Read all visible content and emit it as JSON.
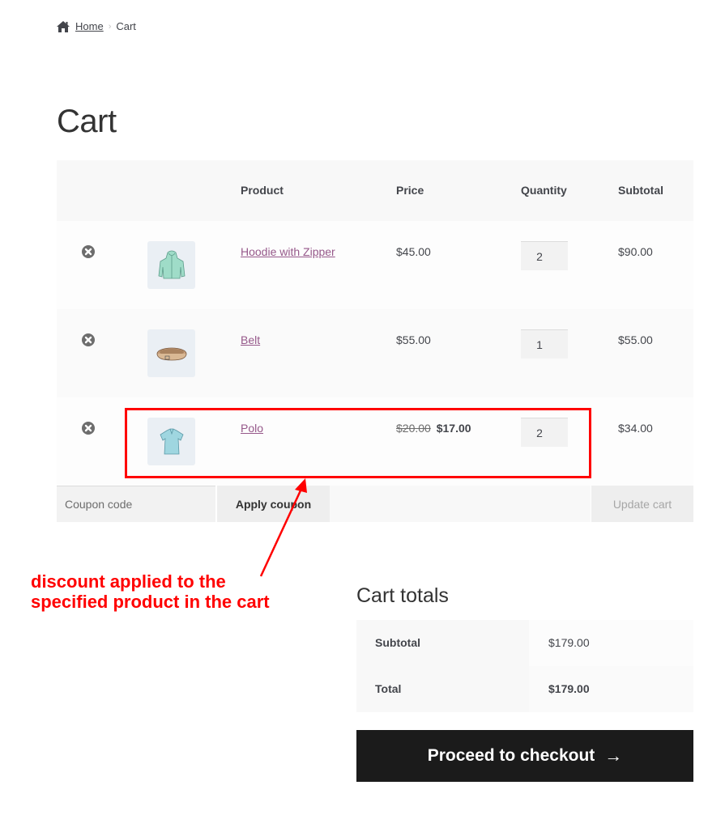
{
  "breadcrumb": {
    "home_label": "Home",
    "separator": "›",
    "current": "Cart"
  },
  "page": {
    "title": "Cart"
  },
  "table": {
    "headers": {
      "product": "Product",
      "price": "Price",
      "quantity": "Quantity",
      "subtotal": "Subtotal"
    },
    "rows": [
      {
        "name": "Hoodie with Zipper",
        "image": "hoodie-thumbnail",
        "price": "$45.00",
        "quantity": "2",
        "subtotal": "$90.00"
      },
      {
        "name": "Belt",
        "image": "belt-thumbnail",
        "price": "$55.00",
        "quantity": "1",
        "subtotal": "$55.00"
      },
      {
        "name": "Polo",
        "image": "polo-thumbnail",
        "regular_price": "$20.00",
        "sale_price": "$17.00",
        "quantity": "2",
        "subtotal": "$34.00"
      }
    ]
  },
  "actions": {
    "coupon_placeholder": "Coupon code",
    "apply_coupon": "Apply coupon",
    "update_cart": "Update cart"
  },
  "annotation": {
    "text": "discount applied to the specified product in the cart",
    "color": "#ff0000"
  },
  "totals": {
    "title": "Cart totals",
    "subtotal_label": "Subtotal",
    "subtotal_value": "$179.00",
    "total_label": "Total",
    "total_value": "$179.00"
  },
  "checkout": {
    "label": "Proceed to checkout",
    "icon": "→"
  },
  "colors": {
    "link": "#96588a",
    "checkout_bg": "#1b1b1b",
    "annotation": "#ff0000"
  }
}
